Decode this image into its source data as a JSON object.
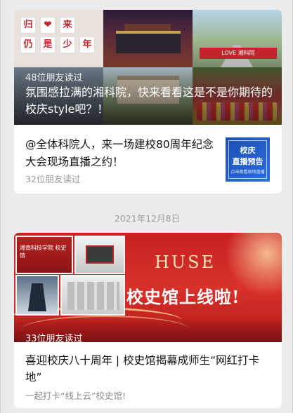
{
  "article1": {
    "hero_readers": "48位朋友读过",
    "hero_title": "氛围感拉满的湘科院，快来看看这是不是你期待的校庆style吧？！",
    "hero_chars": [
      "归",
      "❤",
      "来",
      "仍",
      "是",
      "少",
      "年"
    ],
    "hero_banner": "LOVE 湘科院"
  },
  "article2": {
    "title": "@全体科院人，来一场建校80周年纪念大会现场直播之约！",
    "readers": "32位朋友读过",
    "thumb_line1": "校庆",
    "thumb_line2": "直播预告",
    "thumb_line3": "点击观看现场直播"
  },
  "date_separator": "2021年12月8日",
  "article3": {
    "hero_brand": "HUSE",
    "hero_slogan": "校史馆上线啦!",
    "hero_panel_text": "湘南科技学院 校史馆",
    "hero_readers": "33位朋友读过",
    "title": "喜迎校庆八十周年 | 校史馆揭幕成师生“网红打卡地”",
    "digest": "一起打卡“线上云”校史馆!"
  },
  "colors": {
    "background": "#ececec",
    "card": "#ffffff",
    "muted_text": "#9a9a9a",
    "festive_red": "#c8201f",
    "thumb_blue": "#1c4fb0"
  }
}
